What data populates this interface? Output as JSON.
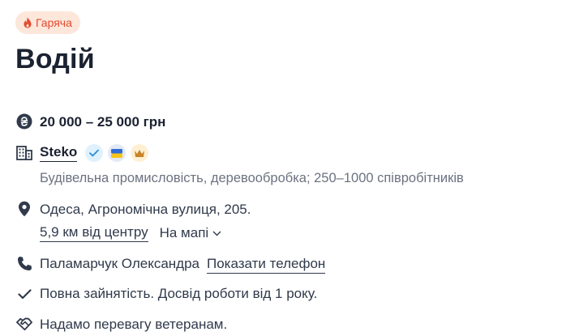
{
  "badge": {
    "label": "Гаряча",
    "color": "#e24b2f"
  },
  "job": {
    "title": "Водій"
  },
  "salary": {
    "text": "20 000 – 25 000 грн"
  },
  "company": {
    "name": "Steko",
    "description": "Будівельна промисловість, деревообробка; 250–1000 співробітників",
    "badges": [
      "check-icon",
      "ukraine-flag-icon",
      "crown-icon"
    ]
  },
  "location": {
    "address": "Одеса, Агрономічна вулиця, 205.",
    "distance": "5,9 км від центру",
    "map_toggle": "На мапі"
  },
  "contact": {
    "name": "Паламарчук Олександра",
    "show_phone": "Показати телефон"
  },
  "employment": {
    "text": "Повна зайнятість. Досвід роботи від 1 року."
  },
  "veterans": {
    "text": "Надамо перевагу ветеранам."
  }
}
